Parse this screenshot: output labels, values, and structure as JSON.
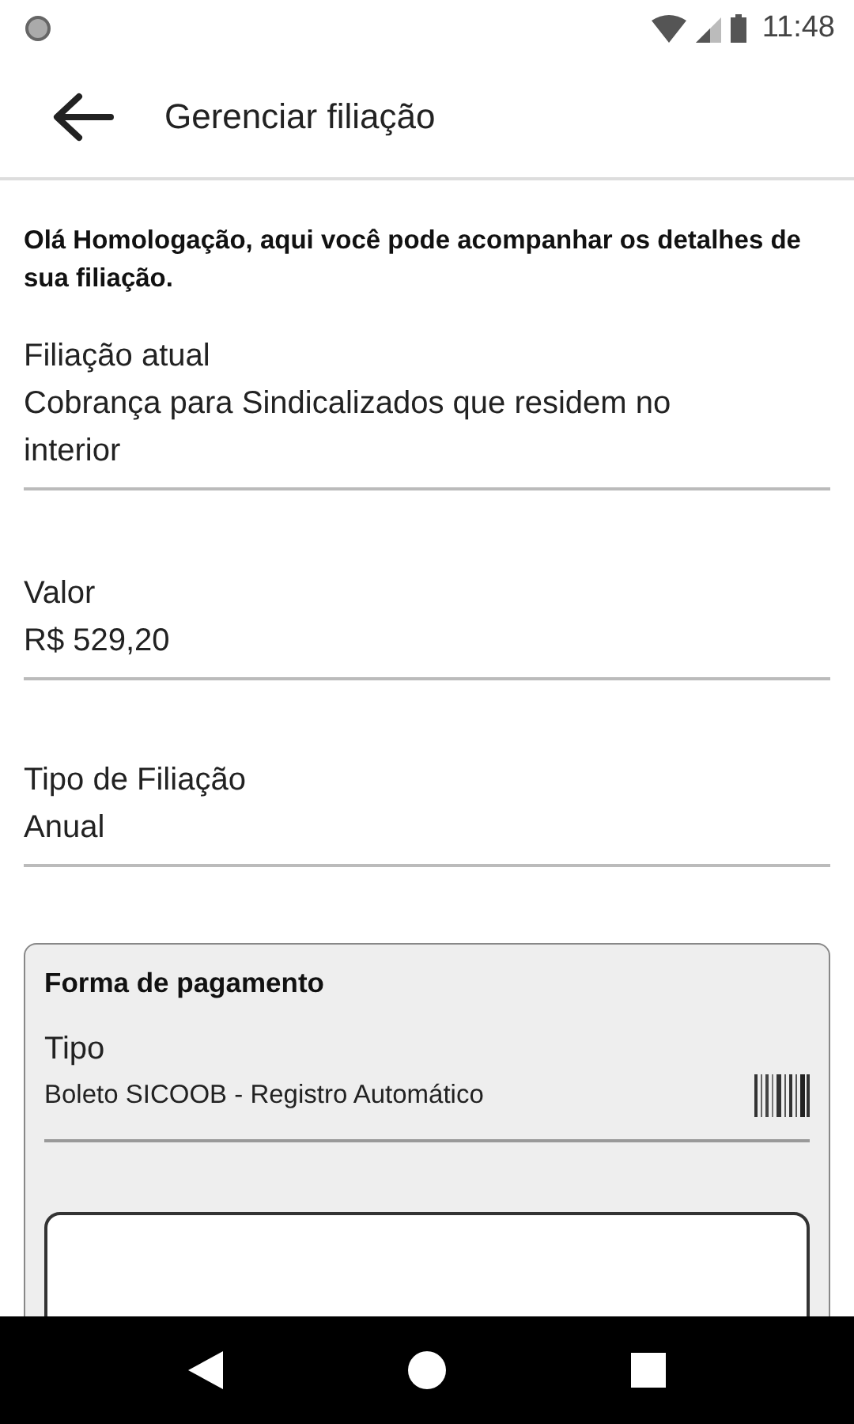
{
  "status_bar": {
    "time": "11:48"
  },
  "app_bar": {
    "title": "Gerenciar filiação"
  },
  "intro": "Olá Homologação, aqui você pode acompanhar os detalhes de sua filiação.",
  "fields": [
    {
      "label": "Filiação atual",
      "value": "Cobrança para Sindicalizados que residem no interior"
    },
    {
      "label": "Valor",
      "value": "R$ 529,20"
    },
    {
      "label": "Tipo de Filiação",
      "value": "Anual"
    }
  ],
  "payment": {
    "title": "Forma de pagamento",
    "type_label": "Tipo",
    "type_value": "Boleto SICOOB - Registro Automático"
  }
}
